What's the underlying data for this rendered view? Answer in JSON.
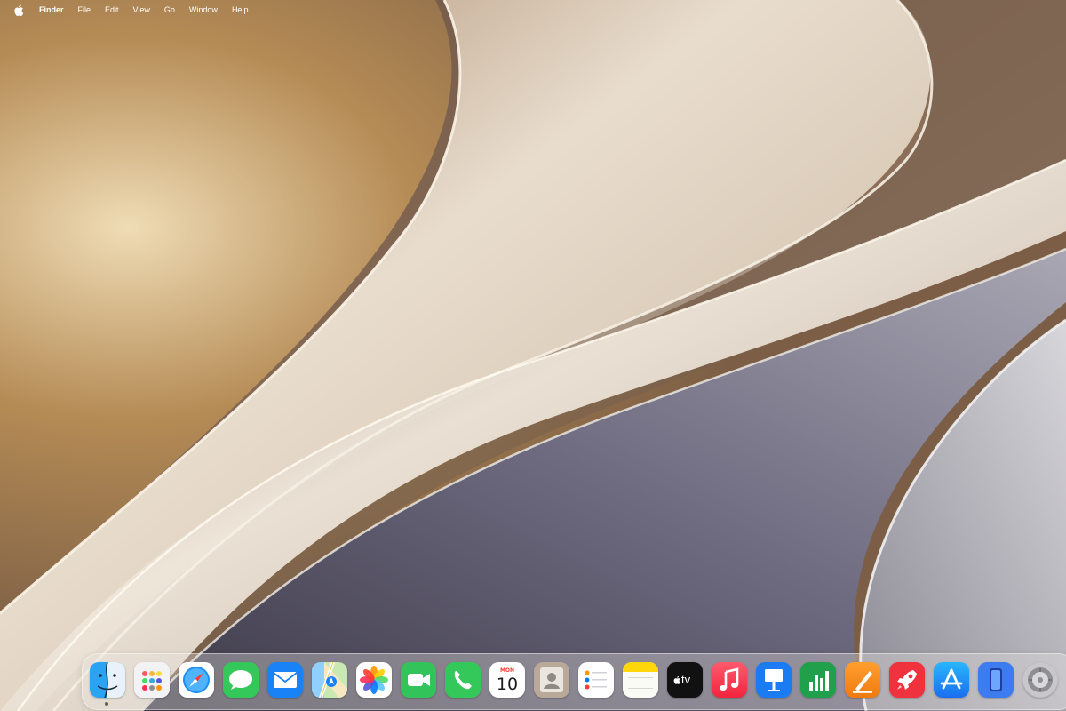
{
  "menubar": {
    "apple_icon": "apple-logo-icon",
    "app_name": "Finder",
    "menus": [
      "File",
      "Edit",
      "View",
      "Go",
      "Window",
      "Help"
    ]
  },
  "dock": {
    "apps": [
      {
        "name": "Finder",
        "icon": "finder-icon",
        "running": true
      },
      {
        "name": "Launchpad",
        "icon": "launchpad-icon"
      },
      {
        "name": "Safari",
        "icon": "safari-icon"
      },
      {
        "name": "Messages",
        "icon": "messages-icon"
      },
      {
        "name": "Mail",
        "icon": "mail-icon"
      },
      {
        "name": "Maps",
        "icon": "maps-icon"
      },
      {
        "name": "Photos",
        "icon": "photos-icon"
      },
      {
        "name": "FaceTime",
        "icon": "facetime-icon"
      },
      {
        "name": "Phone",
        "icon": "phone-icon"
      },
      {
        "name": "Calendar",
        "icon": "calendar-icon",
        "month": "MON",
        "day": "10"
      },
      {
        "name": "Contacts",
        "icon": "contacts-icon"
      },
      {
        "name": "Reminders",
        "icon": "reminders-icon"
      },
      {
        "name": "Notes",
        "icon": "notes-icon"
      },
      {
        "name": "TV",
        "icon": "apple-tv-icon",
        "label": "tv"
      },
      {
        "name": "Music",
        "icon": "music-icon"
      },
      {
        "name": "Keynote",
        "icon": "keynote-icon"
      },
      {
        "name": "Numbers",
        "icon": "numbers-icon"
      },
      {
        "name": "Pages",
        "icon": "pages-icon"
      },
      {
        "name": "Rocket",
        "icon": "rocket-icon"
      },
      {
        "name": "App Store",
        "icon": "app-store-icon"
      },
      {
        "name": "iPhone Mirroring",
        "icon": "iphone-mirroring-icon"
      },
      {
        "name": "System Settings",
        "icon": "system-settings-icon"
      }
    ]
  },
  "colors": {
    "wallpaper_light": "#efe4d2",
    "wallpaper_gold": "#c9a46a",
    "wallpaper_brown": "#6b5647",
    "wallpaper_slate": "#5d5a6b"
  }
}
